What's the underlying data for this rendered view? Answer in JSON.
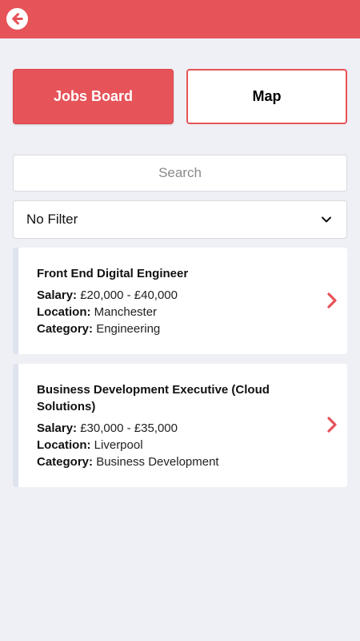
{
  "header": {
    "back_icon": "arrow-left-circle-icon",
    "accent": "#e65358"
  },
  "tabs": [
    {
      "label": "Jobs Board",
      "active": true
    },
    {
      "label": "Map",
      "active": false
    }
  ],
  "search": {
    "placeholder": "Search",
    "value": ""
  },
  "filter": {
    "selected": "No Filter",
    "icon": "chevron-down-icon"
  },
  "jobs": [
    {
      "title": "Front End Digital Engineer",
      "salary_label": "Salary:",
      "salary": "£20,000 - £40,000",
      "location_label": "Location:",
      "location": "Manchester",
      "category_label": "Category:",
      "category": "Engineering"
    },
    {
      "title": "Business Development Executive (Cloud Solutions)",
      "salary_label": "Salary:",
      "salary": "£30,000 - £35,000",
      "location_label": "Location:",
      "location": "Liverpool",
      "category_label": "Category:",
      "category": "Business Development"
    }
  ]
}
